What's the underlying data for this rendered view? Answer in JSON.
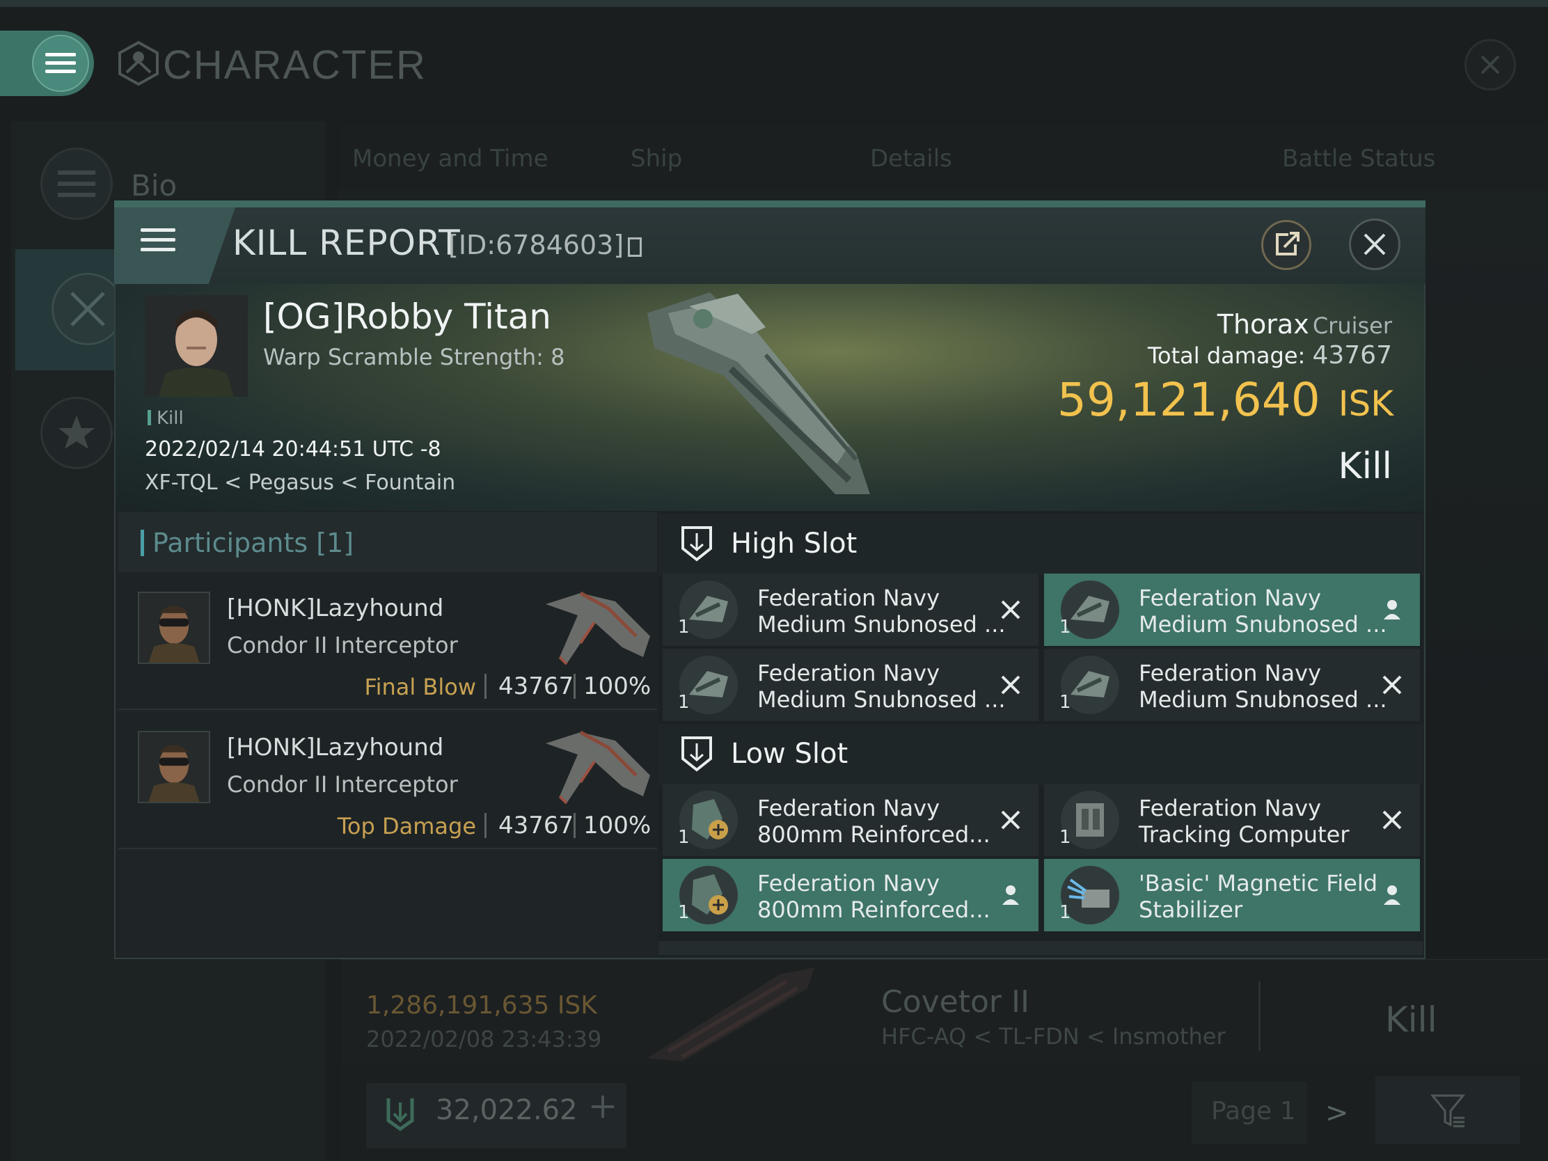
{
  "app": {
    "title": "CHARACTER"
  },
  "sidebar": {
    "bio_label": "Bio"
  },
  "background_tabs": [
    "Money and Time",
    "Ship",
    "Details",
    "Battle Status"
  ],
  "background_row": {
    "isk": "1,286,191,635  ISK",
    "date": "2022/02/08  23:43:39",
    "ship": "Covetor II",
    "location": "HFC-AQ < TL-FDN < Insmother",
    "result": "Kill"
  },
  "wallet": {
    "value": "32,022.62"
  },
  "pager": {
    "label": "Page 1",
    "next": ">"
  },
  "kill_report": {
    "title": "KILL REPORT",
    "id": "[ID:6784603]",
    "victim": {
      "name": "[OG]Robby Titan",
      "warp_scramble": "Warp Scramble Strength: 8",
      "tag": "Kill",
      "datetime": "2022/02/14 20:44:51 UTC -8",
      "location": "XF-TQL < Pegasus < Fountain"
    },
    "ship": {
      "name": "Thorax",
      "class": "Cruiser"
    },
    "total_damage_label": "Total damage:",
    "total_damage": "43767",
    "isk_value": "59,121,640",
    "isk_unit": "ISK",
    "result": "Kill"
  },
  "participants": {
    "label": "Participants [1]",
    "rows": [
      {
        "name": "[HONK]Lazyhound",
        "ship": "Condor II Interceptor",
        "tag": "Final Blow",
        "damage": "43767",
        "percent": "100%"
      },
      {
        "name": "[HONK]Lazyhound",
        "ship": "Condor II Interceptor",
        "tag": "Top Damage",
        "damage": "43767",
        "percent": "100%"
      }
    ]
  },
  "slots": {
    "high": {
      "label": "High Slot",
      "items": [
        {
          "line1": "Federation Navy",
          "line2": "Medium Snubnosed ...",
          "qty": "1",
          "status": "destroyed"
        },
        {
          "line1": "Federation Navy",
          "line2": "Medium Snubnosed ...",
          "qty": "1",
          "status": "dropped"
        },
        {
          "line1": "Federation Navy",
          "line2": "Medium Snubnosed ...",
          "qty": "1",
          "status": "destroyed"
        },
        {
          "line1": "Federation Navy",
          "line2": "Medium Snubnosed ...",
          "qty": "1",
          "status": "destroyed"
        }
      ]
    },
    "low": {
      "label": "Low Slot",
      "items": [
        {
          "line1": "Federation Navy",
          "line2": "800mm Reinforced...",
          "qty": "1",
          "status": "destroyed"
        },
        {
          "line1": "Federation Navy",
          "line2": "Tracking Computer",
          "qty": "1",
          "status": "destroyed"
        },
        {
          "line1": "Federation Navy",
          "line2": "800mm Reinforced...",
          "qty": "1",
          "status": "dropped"
        },
        {
          "line1": "'Basic' Magnetic Field",
          "line2": "Stabilizer",
          "qty": "1",
          "status": "dropped"
        }
      ]
    }
  },
  "colors": {
    "accent": "#3f7468",
    "isk": "#f2c24e",
    "tag": "#c8a152",
    "participants_label": "#5d8b8d"
  }
}
